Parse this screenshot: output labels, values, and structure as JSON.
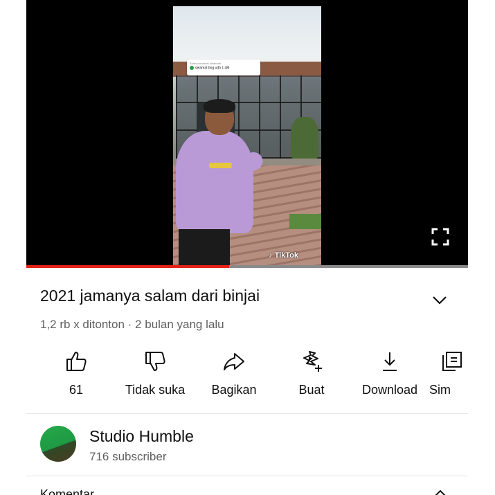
{
  "video": {
    "overlay_comment_header": "Balas komentar salamatd",
    "overlay_comment": "selamat bng udh 1.4M",
    "watermark": "TikTok",
    "progress": 0.46,
    "fullscreen_icon": "fullscreen-icon"
  },
  "title": "2021 jamanya salam dari binjai",
  "meta": "1,2 rb x ditonton · 2 bulan yang lalu",
  "actions": {
    "like": {
      "label": "61",
      "icon": "thumbs-up-icon"
    },
    "dislike": {
      "label": "Tidak suka",
      "icon": "thumbs-down-icon"
    },
    "share": {
      "label": "Bagikan",
      "icon": "share-icon"
    },
    "create": {
      "label": "Buat",
      "icon": "remix-icon"
    },
    "download": {
      "label": "Download",
      "icon": "download-icon"
    },
    "save": {
      "label": "Sim",
      "icon": "save-playlist-icon"
    }
  },
  "channel": {
    "name": "Studio Humble",
    "subscribers": "716 subscriber"
  },
  "comments": {
    "label": "Komentar"
  },
  "colors": {
    "progress": "#e62117",
    "text_primary": "#0f0f0f",
    "text_secondary": "#606060"
  }
}
